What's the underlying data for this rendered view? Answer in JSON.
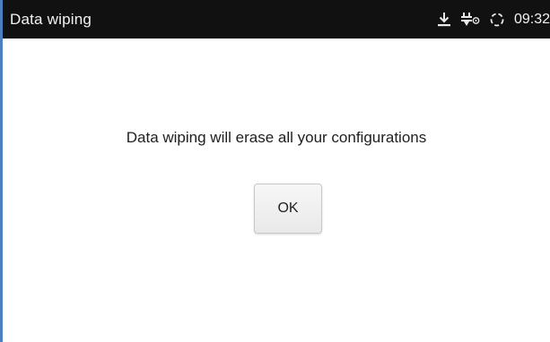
{
  "status_bar": {
    "title": "Data wiping",
    "time": "09:32",
    "icons": [
      "download-icon",
      "usb-debug-icon",
      "sync-icon"
    ]
  },
  "dialog": {
    "message": "Data wiping will erase all your configurations",
    "ok_label": "OK"
  },
  "colors": {
    "status_bar_bg": "#111111",
    "left_edge_accent": "#4a7fc1"
  }
}
